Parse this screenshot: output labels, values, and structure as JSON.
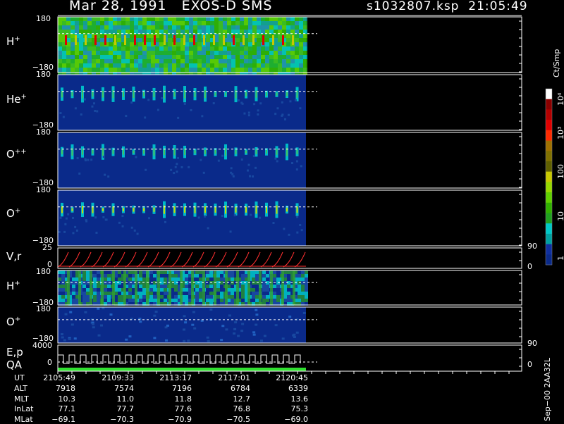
{
  "header": {
    "date_title": "Mar 28, 1991   EXOS-D SMS",
    "file_time": "s1032807.ksp  21:05:49"
  },
  "colorbar": {
    "unit_label": "Ct/Smp",
    "tick_labels": [
      "10⁴",
      "10³",
      "100",
      "10",
      "1"
    ],
    "colors": [
      "#ffffff",
      "#8b0000",
      "#b30000",
      "#e00000",
      "#ff2a00",
      "#a07000",
      "#807000",
      "#606000",
      "#c8c800",
      "#98d800",
      "#60d000",
      "#30b000",
      "#20a020",
      "#00c8c8",
      "#00a0a0",
      "#1030a0",
      "#0a2a8a"
    ]
  },
  "panels": [
    {
      "label": "H",
      "sup": "+",
      "top_tick": "180",
      "bottom_tick": "−180"
    },
    {
      "label": "He",
      "sup": "+",
      "top_tick": "180",
      "bottom_tick": "−180"
    },
    {
      "label": "O",
      "sup": "++",
      "top_tick": "180",
      "bottom_tick": "−180"
    },
    {
      "label": "O",
      "sup": "+",
      "top_tick": "180",
      "bottom_tick": "−180"
    },
    {
      "label": "V,r",
      "sup": "",
      "top_tick": "25",
      "bottom_tick": "0",
      "right_top": "90",
      "right_bottom": "0"
    },
    {
      "label": "H",
      "sup": "+",
      "top_tick": "180",
      "bottom_tick": "−180"
    },
    {
      "label": "O",
      "sup": "+",
      "top_tick": "180",
      "bottom_tick": "−180"
    },
    {
      "label": "E,p",
      "label2": "QA",
      "sup": "",
      "top_tick": "4000",
      "bottom_tick": "0",
      "right_top": "90",
      "right_bottom": "0"
    }
  ],
  "ephemeris": {
    "row_labels": [
      "UT",
      "ALT",
      "MLT",
      "InLat",
      "MLat"
    ],
    "columns": [
      [
        "2105:49",
        "7918",
        "10.3",
        "77.1",
        "−69.1"
      ],
      [
        "2109:33",
        "7574",
        "11.0",
        "77.7",
        "−70.3"
      ],
      [
        "2113:17",
        "7196",
        "11.8",
        "77.6",
        "−70.9"
      ],
      [
        "2117:01",
        "6784",
        "12.7",
        "76.8",
        "−70.5"
      ],
      [
        "2120:45",
        "6339",
        "13.6",
        "75.3",
        "−69.0"
      ]
    ]
  },
  "footer_vertical": "Sep−00  2AA32L",
  "chart_data": {
    "type": "heatmap",
    "title": "Mar 28, 1991   EXOS-D SMS",
    "x": [
      "2105:49",
      "2109:33",
      "2113:17",
      "2117:01",
      "2120:45"
    ],
    "series": [
      {
        "name": "H+",
        "ylim": [
          -180,
          180
        ]
      },
      {
        "name": "He+",
        "ylim": [
          -180,
          180
        ]
      },
      {
        "name": "O++",
        "ylim": [
          -180,
          180
        ]
      },
      {
        "name": "O+",
        "ylim": [
          -180,
          180
        ]
      },
      {
        "name": "V,r",
        "ylim": [
          0,
          25
        ]
      },
      {
        "name": "H+",
        "ylim": [
          -180,
          180
        ]
      },
      {
        "name": "O+",
        "ylim": [
          -180,
          180
        ]
      },
      {
        "name": "E,p",
        "ylim": [
          0,
          4000
        ]
      }
    ],
    "colorbar_ticks": [
      1,
      10,
      100,
      1000,
      10000
    ],
    "colorbar_unit": "Ct/Smp"
  }
}
